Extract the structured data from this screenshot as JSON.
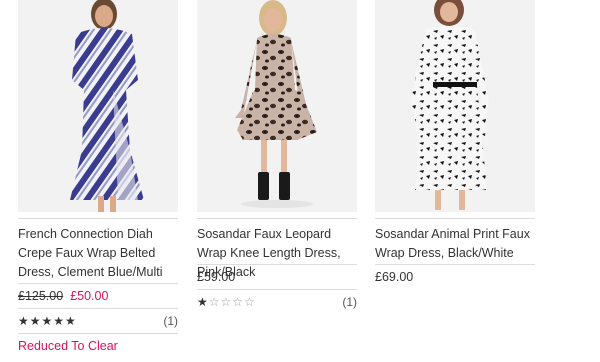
{
  "products": [
    {
      "title": "French Connection Diah Crepe Faux Wrap Belted Dress, Clement Blue/Multi",
      "was_price": "£125.00",
      "now_price": "£50.00",
      "rating_stars": "★★★★★",
      "rating_value": 5,
      "review_count": "(1)",
      "promo": "Reduced To Clear"
    },
    {
      "title": "Sosandar Faux Leopard Wrap Knee Length Dress, Pink/Black",
      "price": "£59.00",
      "rating_filled": "★",
      "rating_empty": "☆☆☆☆",
      "rating_value": 1,
      "review_count": "(1)"
    },
    {
      "title": "Sosandar Animal Print Faux Wrap Dress, Black/White",
      "price": "£69.00"
    }
  ],
  "colors": {
    "sale": "#d4145a",
    "text": "#333333",
    "divider": "#dddddd",
    "image_bg": "#f2f2f2"
  }
}
